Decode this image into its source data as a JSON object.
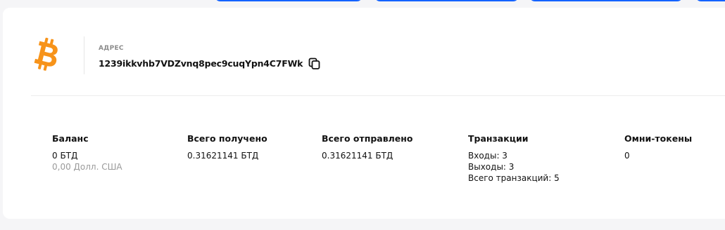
{
  "colors": {
    "accent": "#1463ff",
    "bitcoin_orange": "#f7931a",
    "muted_text": "#9a9a9a"
  },
  "address": {
    "label": "АДРЕС",
    "value": "1239ikkvhb7VDZvnq8pec9cuqYpn4C7FWk",
    "coin_icon": "bitcoin-icon",
    "copy_icon": "copy-icon"
  },
  "stats": {
    "balance": {
      "title": "Баланс",
      "amount": "0 БТД",
      "fiat": "0,00 Долл. США"
    },
    "received": {
      "title": "Всего получено",
      "amount": "0.31621141 БТД"
    },
    "sent": {
      "title": "Всего отправлено",
      "amount": "0.31621141 БТД"
    },
    "transactions": {
      "title": "Транзакции",
      "inputs": "Входы: 3",
      "outputs": "Выходы: 3",
      "total": "Всего транзакций: 5"
    },
    "omni": {
      "title": "Омни-токены",
      "value": "0"
    }
  }
}
